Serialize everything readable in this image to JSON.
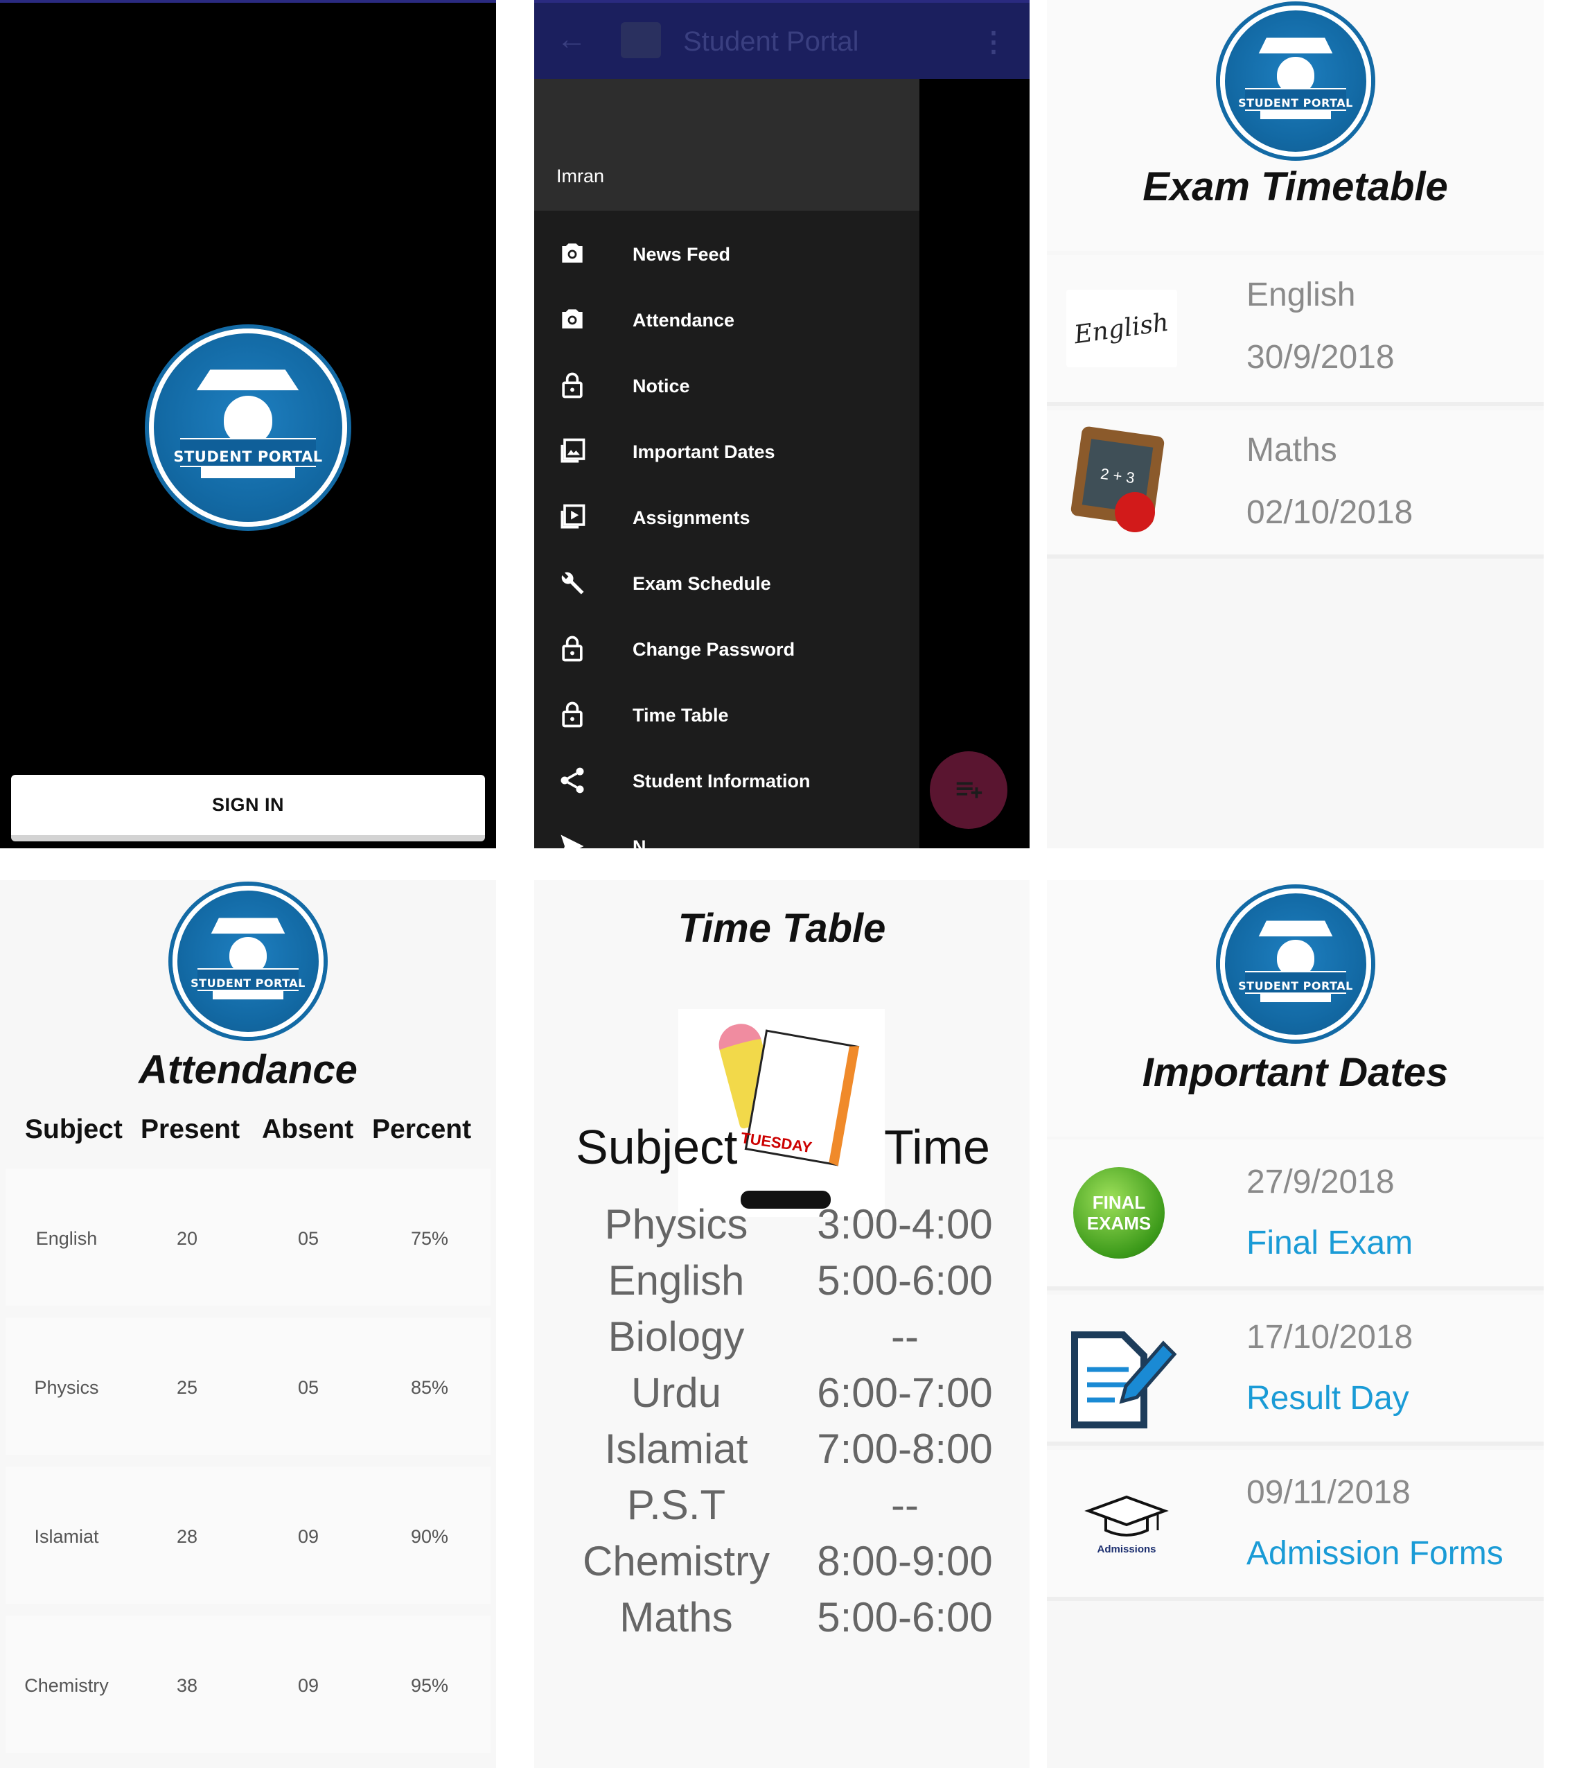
{
  "splash": {
    "logo_text": "STUDENT PORTAL",
    "signin_label": "SIGN IN"
  },
  "drawer": {
    "app_title": "Student Portal",
    "user_name": "Imran",
    "items": [
      {
        "label": "News Feed",
        "icon": "camera-icon"
      },
      {
        "label": "Attendance",
        "icon": "camera-icon"
      },
      {
        "label": "Notice",
        "icon": "lock-icon"
      },
      {
        "label": "Important Dates",
        "icon": "gallery-icon"
      },
      {
        "label": "Assignments",
        "icon": "play-icon"
      },
      {
        "label": "Exam Schedule",
        "icon": "wrench-icon"
      },
      {
        "label": "Change Password",
        "icon": "lock-icon"
      },
      {
        "label": "Time Table",
        "icon": "lock-icon"
      },
      {
        "label": "Student Information",
        "icon": "share-icon"
      },
      {
        "label": "N",
        "icon": "send-icon"
      }
    ]
  },
  "exam": {
    "logo_text": "STUDENT PORTAL",
    "title": "Exam Timetable",
    "rows": [
      {
        "subject": "English",
        "date": "30/9/2018",
        "image_label": "English"
      },
      {
        "subject": "Maths",
        "date": "02/10/2018",
        "image_label": "2 + 3"
      }
    ]
  },
  "attendance": {
    "logo_text": "STUDENT PORTAL",
    "title": "Attendance",
    "headers": [
      "Subject",
      "Present",
      "Absent",
      "Percent"
    ],
    "rows": [
      {
        "subject": "English",
        "present": "20",
        "absent": "05",
        "percent": "75%"
      },
      {
        "subject": "Physics",
        "present": "25",
        "absent": "05",
        "percent": "85%"
      },
      {
        "subject": "Islamiat",
        "present": "28",
        "absent": "09",
        "percent": "90%"
      },
      {
        "subject": "Chemistry",
        "present": "38",
        "absent": "09",
        "percent": "95%"
      }
    ]
  },
  "timetable": {
    "title": "Time Table",
    "header_subject": "Subject",
    "header_time": "Time",
    "sticker_text": "TUESDAY",
    "rows": [
      {
        "subject": "Physics",
        "time": "3:00-4:00"
      },
      {
        "subject": "English",
        "time": "5:00-6:00"
      },
      {
        "subject": "Biology",
        "time": "--"
      },
      {
        "subject": "Urdu",
        "time": "6:00-7:00"
      },
      {
        "subject": "Islamiat",
        "time": "7:00-8:00"
      },
      {
        "subject": "P.S.T",
        "time": "--"
      },
      {
        "subject": "Chemistry",
        "time": "8:00-9:00"
      },
      {
        "subject": "Maths",
        "time": "5:00-6:00"
      }
    ]
  },
  "dates": {
    "logo_text": "STUDENT PORTAL",
    "title": "Important Dates",
    "rows": [
      {
        "date": "27/9/2018",
        "event": "Final Exam",
        "image_label": "FINAL EXAMS"
      },
      {
        "date": "17/10/2018",
        "event": "Result Day",
        "image_label": ""
      },
      {
        "date": "09/11/2018",
        "event": "Admission Forms",
        "image_label": "Admissions"
      }
    ]
  },
  "colors": {
    "accent_blue": "#1a9bd6",
    "logo_blue": "#136aa5",
    "fab": "#5a1530"
  }
}
